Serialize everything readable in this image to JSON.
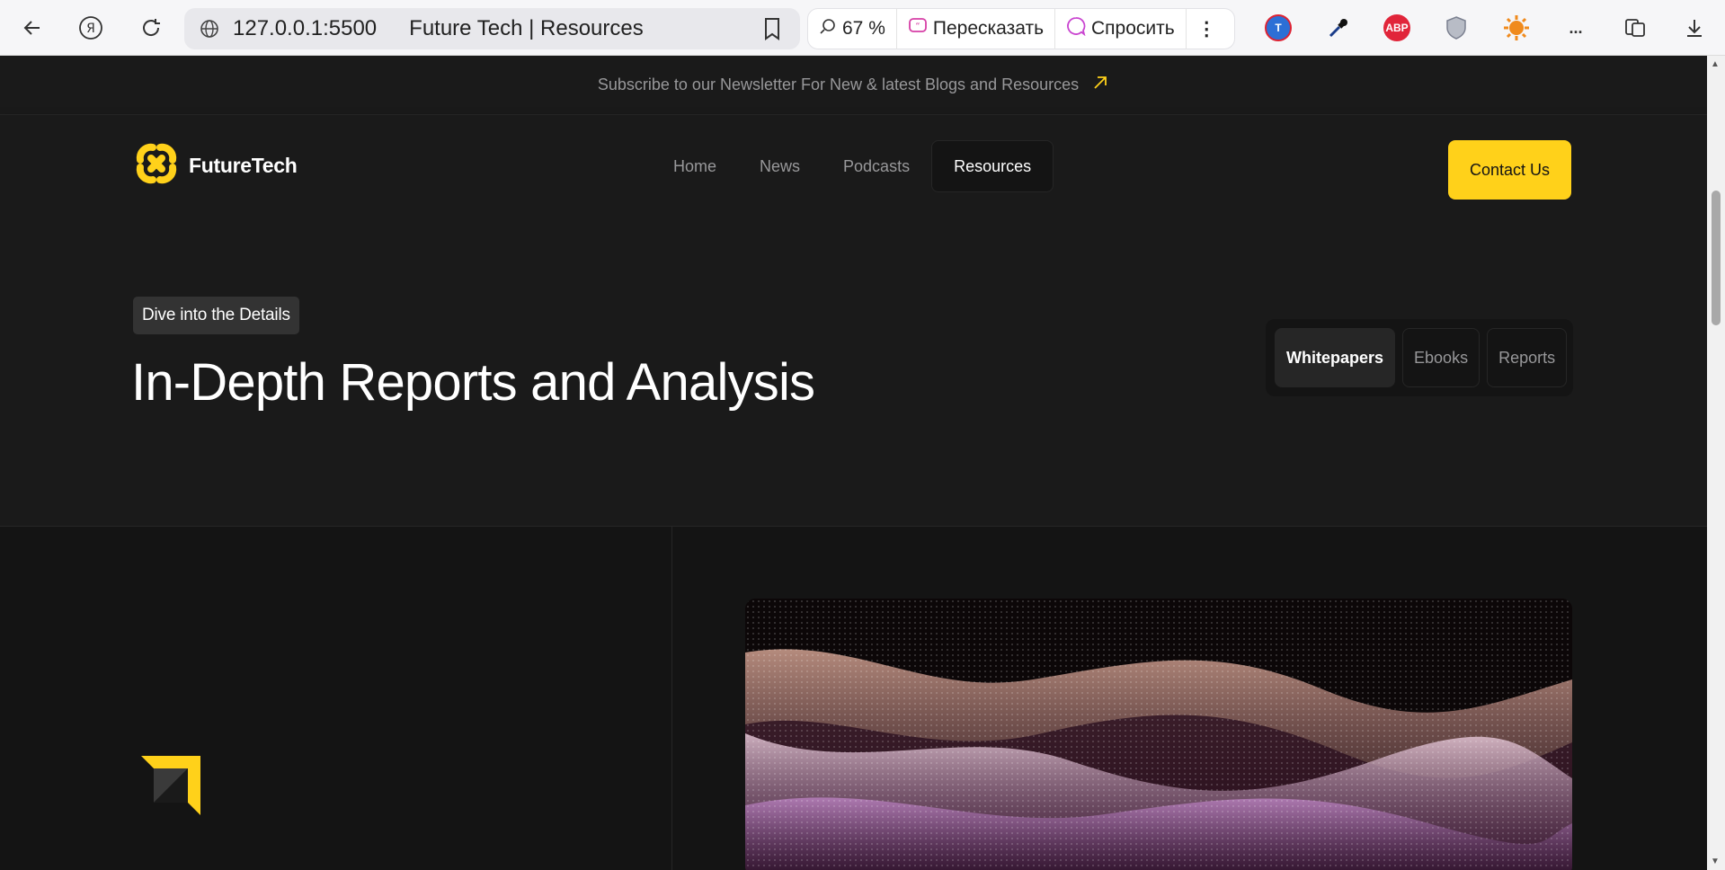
{
  "browser": {
    "url": "127.0.0.1:5500",
    "page_title": "Future Tech | Resources",
    "zoom": "67 %",
    "retell_label": "Пересказать",
    "ask_label": "Спросить",
    "more_ext": "...",
    "ext_abp": "ABP"
  },
  "newsletter": {
    "text": "Subscribe to our Newsletter For New & latest Blogs and Resources"
  },
  "nav": {
    "logo_text": "FutureTech",
    "items": [
      {
        "label": "Home"
      },
      {
        "label": "News"
      },
      {
        "label": "Podcasts"
      },
      {
        "label": "Resources"
      }
    ],
    "active_index": 3,
    "contact_label": "Contact Us"
  },
  "hero": {
    "chip": "Dive into the Details",
    "title": "In-Depth Reports and Analysis",
    "tabs": [
      {
        "label": "Whitepapers"
      },
      {
        "label": "Ebooks"
      },
      {
        "label": "Reports"
      }
    ],
    "active_tab": 0
  },
  "colors": {
    "accent": "#ffd11a",
    "bg": "#141414",
    "panel": "#1a1a1a",
    "border": "#262626",
    "muted_text": "#98989a"
  }
}
